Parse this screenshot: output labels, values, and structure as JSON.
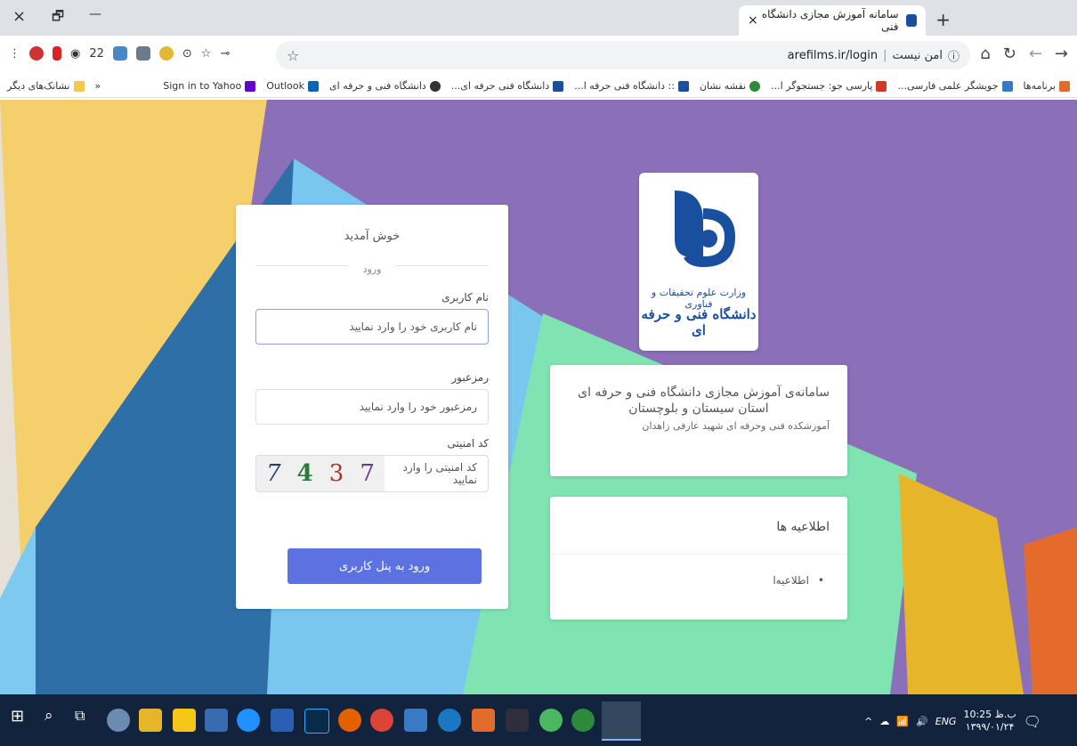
{
  "browser": {
    "tab_title": "سامانه آموزش مجازی دانشگاه فنی",
    "tab_close": "×",
    "new_tab": "+",
    "window_close": "×",
    "window_restore": "🗗",
    "window_minimize": "—",
    "security_text": "امن نیست",
    "url": "arefilms.ir/login",
    "extension_count": "22",
    "bookmarks": [
      "برنامه‌ها",
      "جویشگر علمی فارسی...",
      "پارسی جو: جستجوگر ا...",
      "نقشه نشان",
      ":: دانشگاه فنی حرفه ا...",
      "دانشگاه فنی حرفه ای...",
      "دانشگاه فنی و حرفه ای",
      "Outlook",
      "Sign in to Yahoo"
    ],
    "more_bookmarks": "«",
    "other_bookmarks": "نشانک‌های دیگر"
  },
  "login": {
    "welcome": "خوش آمدید",
    "section": "ورود",
    "username_label": "نام کاربری",
    "username_placeholder": "نام کاربری خود را وارد نمایید",
    "password_label": "رمزعبور",
    "password_placeholder": "رمزعبور خود را وارد نمایید",
    "captcha_label": "کد امنیتی",
    "captcha_placeholder": "کد امنیتی را وارد نمایید",
    "captcha_digits": [
      "7",
      "4",
      "3",
      "7"
    ],
    "submit": "ورود به پنل کاربری"
  },
  "logo": {
    "line1": "وزارت علوم تحقیقات و فناوری",
    "line2": "دانشگاه فنی و حرفه ای"
  },
  "info": {
    "title_line1": "سامانه‌ی آموزش مجازی دانشگاه فنی و حرفه ای",
    "title_line2": "استان سیستان و بلوچستان",
    "subtitle": "آموزشکده فنی وحرفه ای شهید عارفی زاهدان"
  },
  "news": {
    "heading": "اطلاعیه ها",
    "items": [
      "اطلاعیه‌ا"
    ]
  },
  "taskbar": {
    "lang": "ENG",
    "time": "10:25 ب.ظ",
    "date": "۱۳۹۹/۰۱/۲۴"
  },
  "colors": {
    "submit": "#5b72e0",
    "brand": "#1a4fa0",
    "background": "#7a5da8"
  }
}
